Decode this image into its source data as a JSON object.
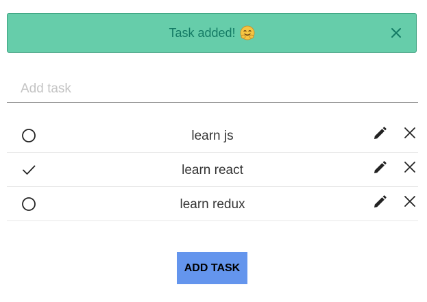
{
  "toast": {
    "message": "Task added!",
    "emoji_icon": "hugging-smile-emoji",
    "close_icon": "close-icon",
    "background": "#66cdaa",
    "text_color": "#137a64"
  },
  "add_task_input": {
    "value": "",
    "placeholder": "Add task"
  },
  "tasks": [
    {
      "label": "learn js",
      "done": false,
      "status_icon": "circle-icon",
      "edit_icon": "pencil-icon",
      "delete_icon": "close-icon"
    },
    {
      "label": "learn react",
      "done": true,
      "status_icon": "check-icon",
      "edit_icon": "pencil-icon",
      "delete_icon": "close-icon"
    },
    {
      "label": "learn redux",
      "done": false,
      "status_icon": "circle-icon",
      "edit_icon": "pencil-icon",
      "delete_icon": "close-icon"
    }
  ],
  "add_button": {
    "label": "ADD TASK",
    "background": "#6495ed"
  }
}
